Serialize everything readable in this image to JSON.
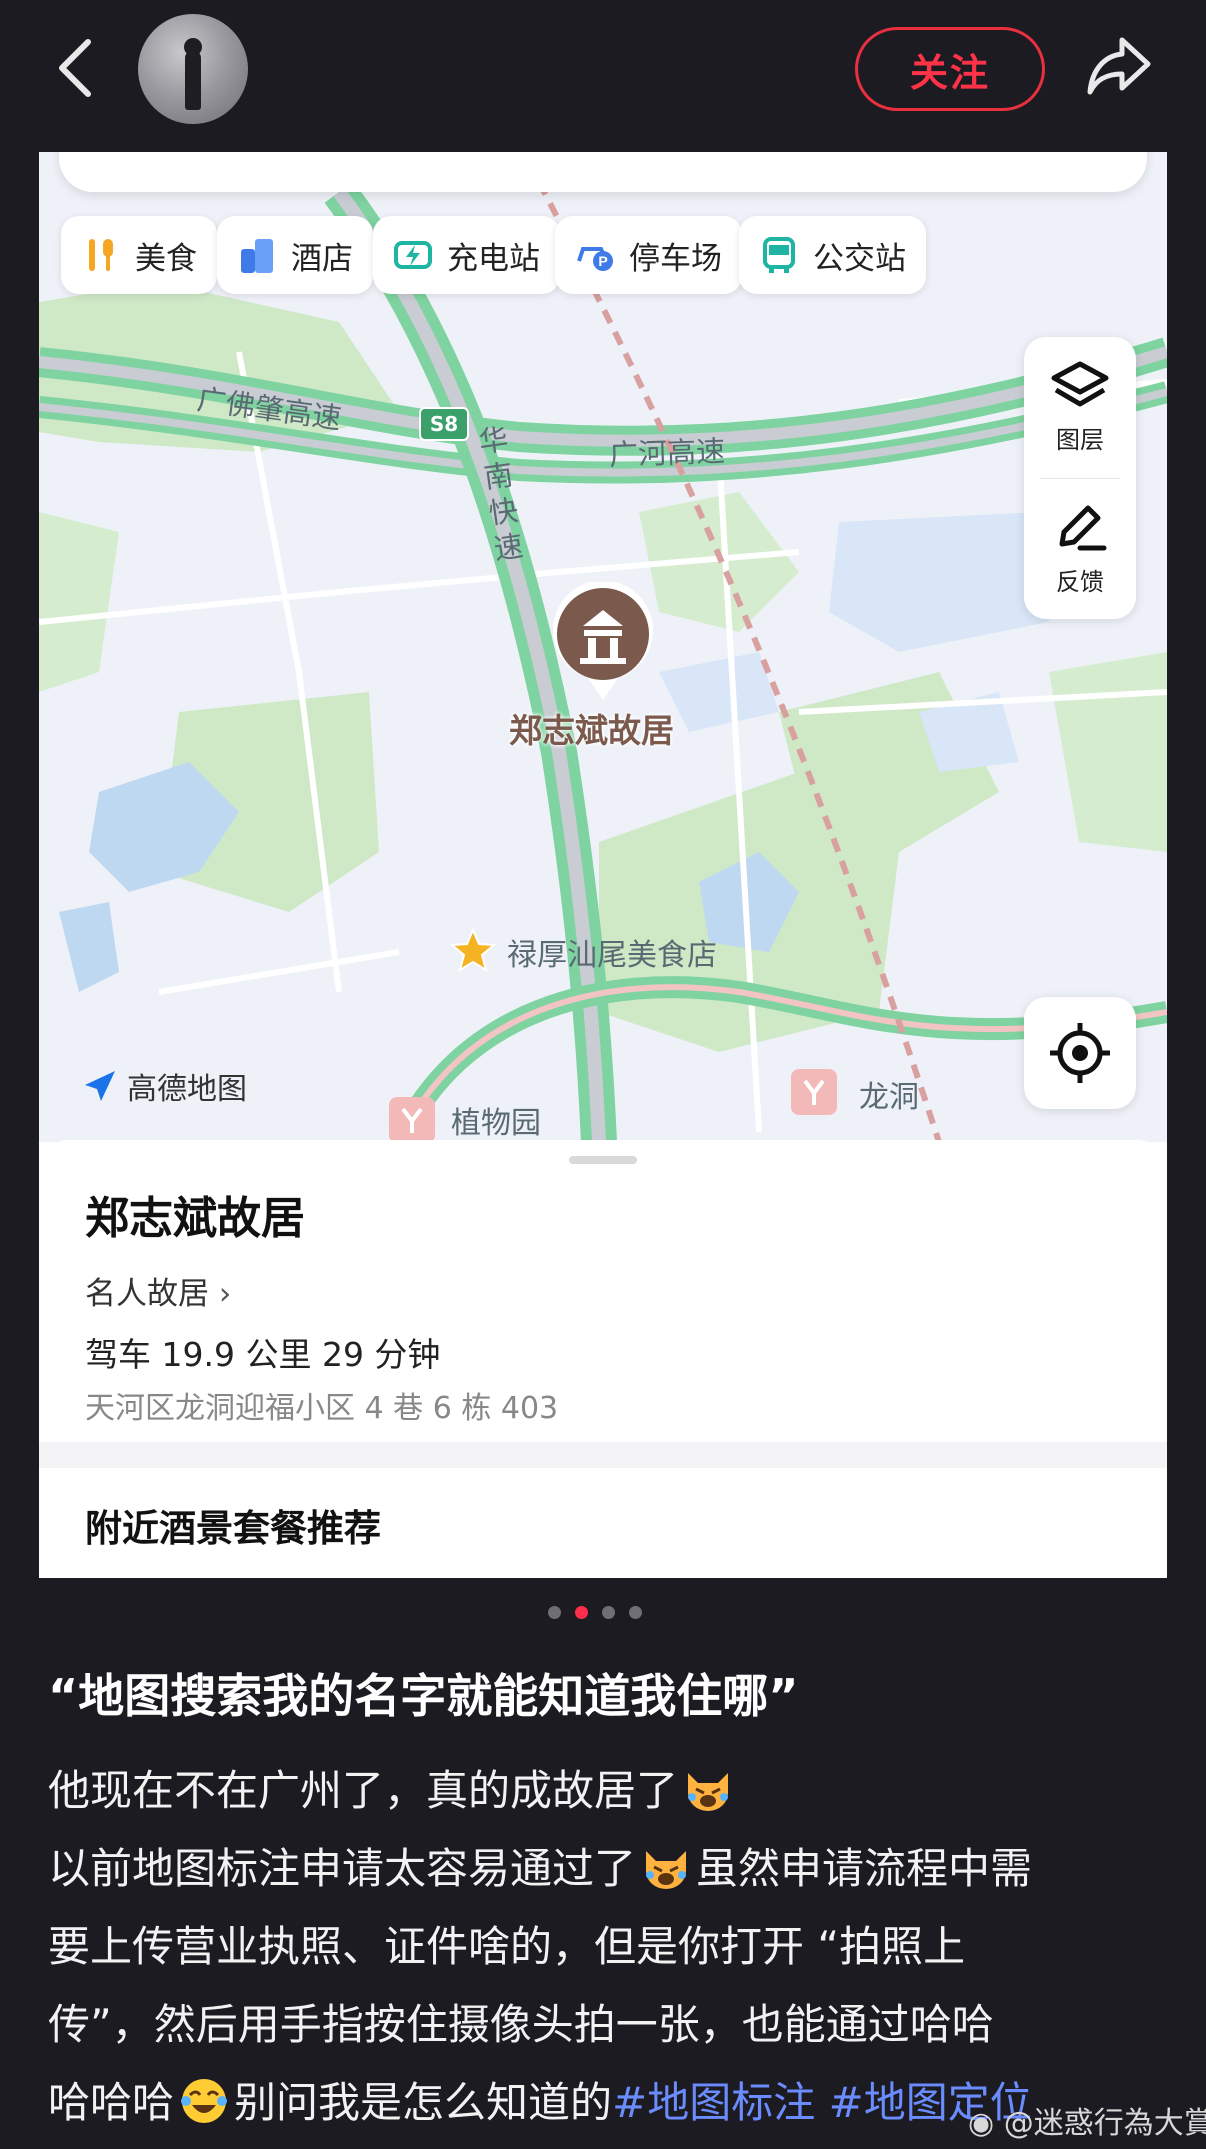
{
  "header": {
    "follow_label": "关注"
  },
  "map": {
    "categories": [
      {
        "label": "美食",
        "icon": "food-icon"
      },
      {
        "label": "酒店",
        "icon": "hotel-icon"
      },
      {
        "label": "充电站",
        "icon": "charging-station-icon"
      },
      {
        "label": "停车场",
        "icon": "parking-icon"
      },
      {
        "label": "公交站",
        "icon": "bus-icon"
      }
    ],
    "road_labels": {
      "guangfozhao": "广佛肇高速",
      "guanghe": "广河高速",
      "huanan": "华南快速",
      "s8": "S8"
    },
    "side_buttons": {
      "layers_label": "图层",
      "feedback_label": "反馈"
    },
    "poi_name": "郑志斌故居",
    "star_poi_name": "禄厚汕尾美食店",
    "metro_stations": [
      "植物园",
      "龙洞"
    ],
    "logo_text": "高德地图",
    "colors": {
      "road_green": "#7ed3a0",
      "poi_brown": "#7b5a4d",
      "park_green": "#cfe9c7"
    }
  },
  "sheet": {
    "title": "郑志斌故居",
    "category": "名人故居",
    "drive_info": "驾车 19.9 公里 29 分钟",
    "address": "天河区龙洞迎福小区 4 巷 6 栋 403",
    "nearby_title": "附近酒景套餐推荐"
  },
  "carousel": {
    "total": 4,
    "active_index": 1
  },
  "caption": {
    "title": "“地图搜索我的名字就能知道我住哪”",
    "line1": "他现在不在广州了，真的成故居了",
    "line2a": "以前地图标注申请太容易通过了",
    "line2b": "虽然申请流程中需",
    "line3": "要上传营业执照、证件啥的，但是你打开 “拍照上",
    "line4": "传”，然后用手指按住摄像头拍一张，也能通过哈哈",
    "line5a": "哈哈哈",
    "line5b": "别问我是怎么知道的",
    "hashtag1": "#地图标注",
    "hashtag2": "#地图定位",
    "watermark": "@迷惑行為大賞"
  }
}
